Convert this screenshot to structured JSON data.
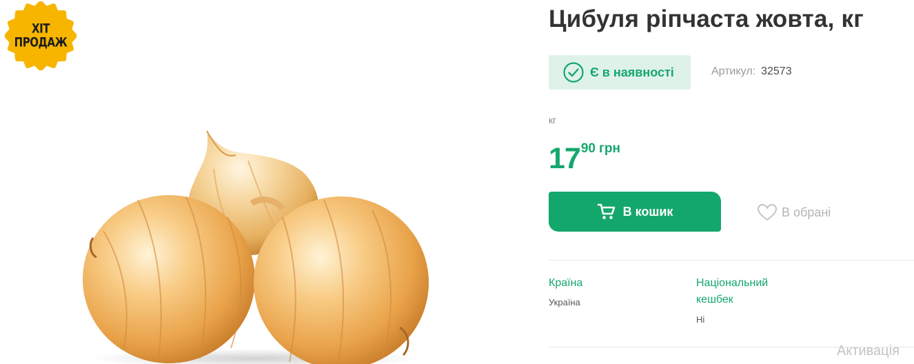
{
  "badge": {
    "line1": "ХІТ",
    "line2": "ПРОДАЖ",
    "color": "#f7b500"
  },
  "product": {
    "title": "Цибуля ріпчаста жовта, кг",
    "image_icon": "onion-product-image"
  },
  "stock": {
    "label": "Є в наявності",
    "icon": "check-circle-icon"
  },
  "sku": {
    "label": "Артикул:",
    "value": "32573"
  },
  "unit": "кг",
  "price": {
    "integer": "17",
    "fraction": "90",
    "currency": "грн"
  },
  "actions": {
    "cart_label": "В кошик",
    "cart_icon": "cart-icon",
    "favorite_label": "В обрані",
    "favorite_icon": "heart-icon"
  },
  "attributes": [
    {
      "name": "Країна",
      "value": "Україна"
    },
    {
      "name": "Національний кешбек",
      "value": "Ні"
    }
  ],
  "watermark": "Активація",
  "colors": {
    "accent": "#14a76c",
    "accent_light": "#dff2ea",
    "badge_yellow": "#f7b500"
  }
}
